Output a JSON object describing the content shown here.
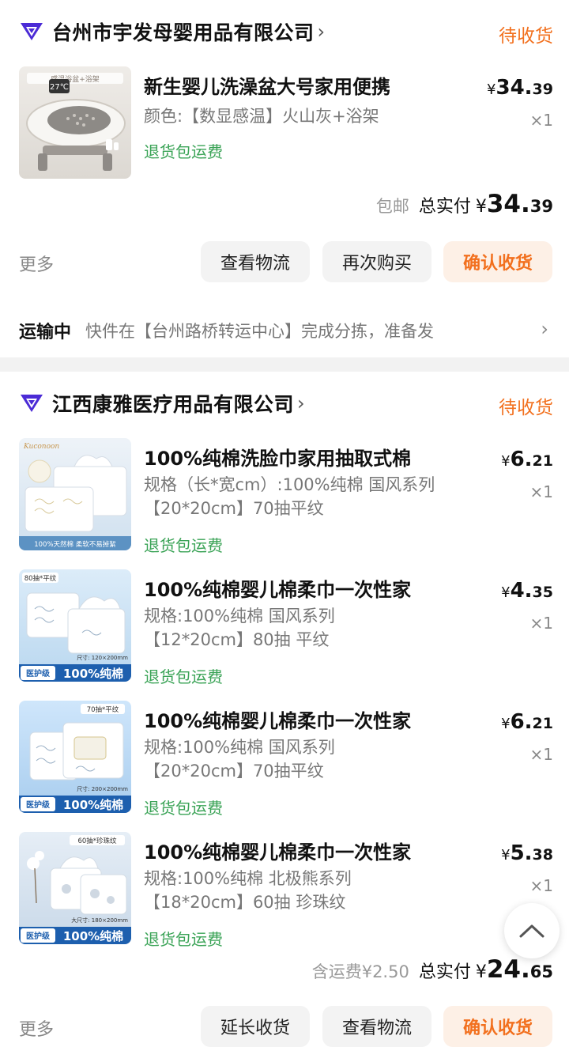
{
  "order1": {
    "store_name": "台州市宇发母婴用品有限公司",
    "store_chevron": "›",
    "status": "待收货",
    "item": {
      "image_label": "感温浴盆+浴架",
      "image_temp": "27℃",
      "title": "新生婴儿洗澡盆大号家用便携",
      "spec": "颜色:【数显感温】火山灰+浴架",
      "refund": "退货包运费",
      "price_yen": "¥",
      "price_int": "34.",
      "price_dec": "39",
      "qty": "×1"
    },
    "total": {
      "shipping_note": "包邮",
      "label": "总实付",
      "yen": "¥",
      "int": "34.",
      "dec": "39"
    },
    "more": "更多",
    "buttons": [
      "查看物流",
      "再次购买",
      "确认收货"
    ],
    "shipping": {
      "label": "运输中",
      "text": "快件在【台州路桥转运中心】完成分拣，准备发",
      "chevron": "›"
    }
  },
  "order2": {
    "store_name": "江西康雅医疗用品有限公司",
    "store_chevron": "›",
    "status": "待收货",
    "items": [
      {
        "image_brand": "Kuconoon",
        "image_footer": "100%天然棉 柔软不易掉絮",
        "title": "100%纯棉洗脸巾家用抽取式棉",
        "spec": "规格（长*宽cm）:100%纯棉 国风系列【20*20cm】70抽平纹",
        "refund": "退货包运费",
        "price_yen": "¥",
        "price_int": "6.",
        "price_dec": "21",
        "qty": "×1"
      },
      {
        "image_tag": "80抽*平纹",
        "image_size": "尺寸: 120×200mm",
        "image_badge": "医护级",
        "image_slogan": "100%纯棉",
        "title": "100%纯棉婴儿棉柔巾一次性家",
        "spec": "规格:100%纯棉 国风系列【12*20cm】80抽 平纹",
        "refund": "退货包运费",
        "price_yen": "¥",
        "price_int": "4.",
        "price_dec": "35",
        "qty": "×1"
      },
      {
        "image_tag": "70抽*平纹",
        "image_size": "尺寸: 200×200mm",
        "image_badge": "医护级",
        "image_slogan": "100%纯棉",
        "title": "100%纯棉婴儿棉柔巾一次性家",
        "spec": "规格:100%纯棉 国风系列【20*20cm】70抽平纹",
        "refund": "退货包运费",
        "price_yen": "¥",
        "price_int": "6.",
        "price_dec": "21",
        "qty": "×1"
      },
      {
        "image_tag": "60抽*珍珠纹",
        "image_size": "大尺寸: 180×200mm",
        "image_badge": "医护级",
        "image_slogan": "100%纯棉",
        "title": "100%纯棉婴儿棉柔巾一次性家",
        "spec": "规格:100%纯棉 北极熊系列【18*20cm】60抽 珍珠纹",
        "refund": "退货包运费",
        "price_yen": "¥",
        "price_int": "5.",
        "price_dec": "38",
        "qty": "×1"
      }
    ],
    "total": {
      "shipping_note": "含运费¥2.50",
      "label": "总实付",
      "yen": "¥",
      "int": "24.",
      "dec": "65"
    },
    "more": "更多",
    "buttons": [
      "延长收货",
      "查看物流",
      "确认收货"
    ]
  },
  "icons": {
    "store": "store-badge-icon",
    "scroll_top": "chevron-up-icon"
  },
  "colors": {
    "accent_orange": "#f2701e",
    "refund_green": "#3aa356",
    "store_badge_purple": "#4b2bd6"
  }
}
